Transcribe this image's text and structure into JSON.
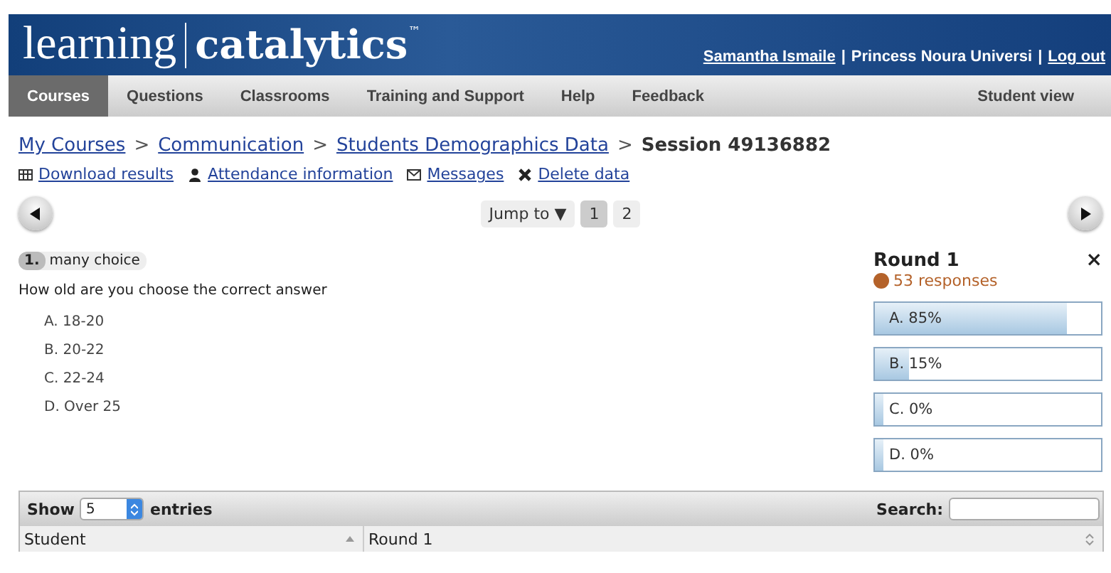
{
  "header": {
    "logo_light": "learning",
    "logo_bold": "catalytics",
    "trademark": "™",
    "user_bar": [
      {
        "kind": "link",
        "text": "Samantha Ismaile"
      },
      {
        "kind": "separator",
        "text": "|"
      },
      {
        "kind": "text",
        "text": "Princess Noura Universi"
      },
      {
        "kind": "separator",
        "text": "|"
      },
      {
        "kind": "link",
        "text": "Log out"
      }
    ]
  },
  "nav": {
    "items": [
      {
        "label": "Courses",
        "selected": true
      },
      {
        "label": "Questions",
        "selected": false
      },
      {
        "label": "Classrooms",
        "selected": false
      },
      {
        "label": "Training and Support",
        "selected": false
      },
      {
        "label": "Help",
        "selected": false
      },
      {
        "label": "Feedback",
        "selected": false
      }
    ],
    "right": "Student view"
  },
  "breadcrumb": [
    {
      "kind": "link",
      "text": "My Courses"
    },
    {
      "kind": "separator",
      "text": ">"
    },
    {
      "kind": "link",
      "text": "Communication"
    },
    {
      "kind": "separator",
      "text": ">"
    },
    {
      "kind": "link",
      "text": "Students Demographics Data"
    },
    {
      "kind": "separator",
      "text": ">"
    },
    {
      "kind": "current",
      "text": "Session 49136882"
    }
  ],
  "actions": [
    {
      "kind": "table",
      "label": "Download results"
    },
    {
      "kind": "person",
      "label": "Attendance information"
    },
    {
      "kind": "mail",
      "label": "Messages"
    },
    {
      "kind": "delete",
      "label": "Delete data"
    }
  ],
  "pager": {
    "jump": "Jump to ▼",
    "pages": [
      {
        "label": "1",
        "selected": true
      },
      {
        "label": "2",
        "selected": false
      }
    ]
  },
  "question": {
    "number": "1.",
    "type": "many choice",
    "text": "How old are you choose the correct answer",
    "options": [
      "A. 18-20",
      "B. 20-22",
      "C. 22-24",
      "D. Over 25"
    ]
  },
  "results": {
    "title": "Round 1",
    "close": "×",
    "responses": "53 responses",
    "bars": [
      {
        "label": "A. 85%",
        "level": 0.85
      },
      {
        "label": "B. 15%",
        "level": 0.15
      },
      {
        "label": "C. 0%",
        "level": 0
      },
      {
        "label": "D. 0%",
        "level": 0
      }
    ]
  },
  "table": {
    "show": "Show",
    "page_size": "5",
    "entries": "entries",
    "search_label": "Search:",
    "columns": [
      "Student",
      "Round 1"
    ]
  }
}
